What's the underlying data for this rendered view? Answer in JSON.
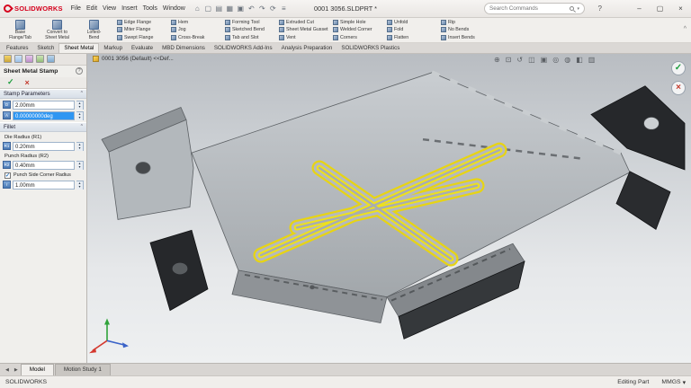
{
  "colors": {
    "accent_red": "#d6001c",
    "select_blue": "#2f96f2",
    "stamp_yellow": "#eee11c",
    "ok_green": "#1d9e3e",
    "cancel_red": "#c43c2e"
  },
  "titlebar": {
    "logo_text": "SOLIDWORKS",
    "menus": [
      "File",
      "Edit",
      "View",
      "Insert",
      "Tools",
      "Window"
    ],
    "quick_icons": [
      {
        "name": "home-icon",
        "glyph": "⌂"
      },
      {
        "name": "new-icon",
        "glyph": "▢"
      },
      {
        "name": "open-icon",
        "glyph": "▤"
      },
      {
        "name": "save-icon",
        "glyph": "▦"
      },
      {
        "name": "print-icon",
        "glyph": "▣"
      },
      {
        "name": "undo-icon",
        "glyph": "↶"
      },
      {
        "name": "redo-icon",
        "glyph": "↷"
      },
      {
        "name": "rebuild-icon",
        "glyph": "⟳"
      },
      {
        "name": "options-icon",
        "glyph": "≡"
      }
    ],
    "document_name": "0001 3056.SLDPRT *",
    "search_placeholder": "Search Commands",
    "search_chevron": "▾",
    "help_icon": "?",
    "minimize": "–",
    "maximize": "▢",
    "close": "×"
  },
  "ribbon": {
    "large": [
      {
        "line1": "Base",
        "line2": "Flange/Tab"
      },
      {
        "line1": "Convert to",
        "line2": "Sheet Metal"
      },
      {
        "line1": "Lofted-",
        "line2": "Bend"
      }
    ],
    "items": [
      "Edge Flange",
      "Miter Flange",
      "Swept Flange",
      "Hem",
      "Jog",
      "Cross-Break",
      "Forming Tool",
      "Sketched Bend",
      "Tab and Slot",
      "Extruded Cut",
      "Sheet Metal Gusset",
      "Vent",
      "Simple Hole",
      "Welded Corner",
      "Corners",
      "Unfold",
      "Fold",
      "Flatten",
      "Rip",
      "No Bends",
      "Insert Bends"
    ],
    "collapse_glyph": "^"
  },
  "tabs": {
    "items": [
      "Features",
      "Sketch",
      "Sheet Metal",
      "Markup",
      "Evaluate",
      "MBD Dimensions",
      "SOLIDWORKS Add-Ins",
      "Analysis Preparation",
      "SOLIDWORKS Plastics"
    ]
  },
  "pm": {
    "title": "Sheet Metal Stamp",
    "help_icon": "?",
    "ok_icon": "✓",
    "cancel_icon": "×",
    "group1": "Stamp Parameters",
    "group2": "Fillet",
    "chevron": "^",
    "icons": {
      "depth": "D",
      "angle": "A",
      "die": "R1",
      "punch": "R2",
      "corner": "r"
    },
    "depth_value": "2.00mm",
    "angle_value": "0.00000000deg",
    "die_label": "Die Radius (R1)",
    "die_value": "0.20mm",
    "punch_label": "Punch Radius (R2)",
    "punch_value": "0.40mm",
    "corner_check_label": "Punch Side Corner Radius",
    "check_glyph": "✓",
    "corner_value": "1.00mm",
    "spin_up": "▴",
    "spin_down": "▾"
  },
  "viewport": {
    "breadcrumb": "0001 3056 (Default) <<Def...",
    "hud": [
      {
        "name": "zoom-fit-icon",
        "glyph": "⊕"
      },
      {
        "name": "zoom-area-icon",
        "glyph": "⊡"
      },
      {
        "name": "previous-view-icon",
        "glyph": "↺"
      },
      {
        "name": "section-view-icon",
        "glyph": "◫"
      },
      {
        "name": "view-orientation-icon",
        "glyph": "▣"
      },
      {
        "name": "display-style-icon",
        "glyph": "◎"
      },
      {
        "name": "hide-show-icon",
        "glyph": "◍"
      },
      {
        "name": "appearance-icon",
        "glyph": "◧"
      },
      {
        "name": "scene-icon",
        "glyph": "▥"
      }
    ],
    "confirm_ok": "✓",
    "confirm_cancel": "×"
  },
  "bottom": {
    "nav": [
      "◀",
      "▶"
    ],
    "tabs": [
      "Model",
      "Motion Study 1"
    ],
    "status_left": "SOLIDWORKS",
    "status_editing": "Editing Part",
    "status_units": "MMGS",
    "units_arrow": "▾"
  }
}
